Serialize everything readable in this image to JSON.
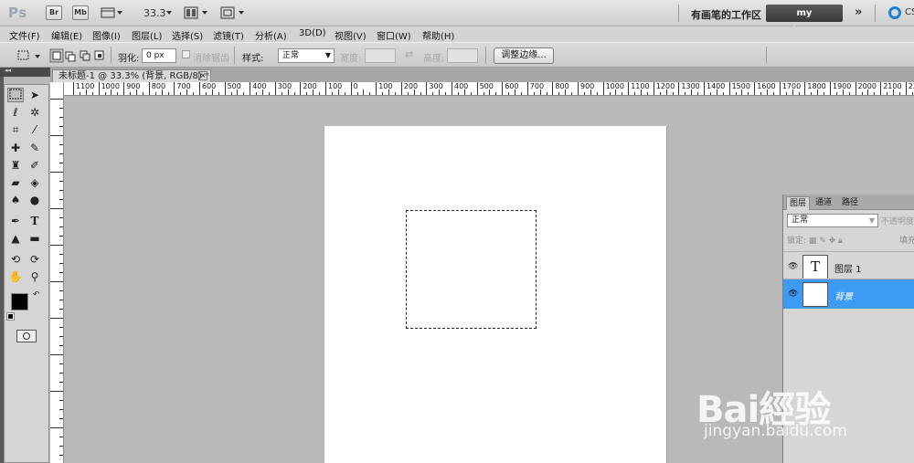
{
  "app": {
    "logo": "Ps",
    "bridge_btn": "Br",
    "minibridge_btn": "Mb",
    "zoom": "33.3",
    "workspace_label": "有画笔的工作区",
    "workspace_active": "my workspace1",
    "more": "»",
    "cs_label": "CS"
  },
  "menus": [
    "文件(F)",
    "编辑(E)",
    "图像(I)",
    "图层(L)",
    "选择(S)",
    "滤镜(T)",
    "分析(A)",
    "3D(D)",
    "视图(V)",
    "窗口(W)",
    "帮助(H)"
  ],
  "options": {
    "feather_label": "羽化:",
    "feather_value": "0 px",
    "antialias_label": "消除锯齿",
    "style_label": "样式:",
    "style_value": "正常",
    "width_label": "宽度:",
    "height_label": "高度:",
    "refine_btn": "调整边缘..."
  },
  "document": {
    "tab_title": "未标题-1 @ 33.3% (背景, RGB/8) *",
    "close": "×",
    "ruler_labels": [
      "1100",
      "1000",
      "900",
      "800",
      "700",
      "600",
      "500",
      "400",
      "300",
      "200",
      "100",
      "0",
      "100",
      "200",
      "300",
      "400",
      "500",
      "600",
      "700",
      "800",
      "900",
      "1000",
      "1100",
      "1200",
      "1300",
      "1400",
      "1500",
      "1600",
      "1700",
      "1800",
      "1900",
      "2000",
      "2100",
      "2200",
      "2300"
    ]
  },
  "layers_panel": {
    "tabs": [
      "图层",
      "通道",
      "路径"
    ],
    "blend_mode": "正常",
    "opacity_label": "不透明度",
    "lock_label": "锁定:",
    "fill_label": "填充",
    "layers": [
      {
        "name": "图层 1",
        "thumb": "T",
        "selected": false,
        "italic": false
      },
      {
        "name": "背景",
        "thumb": "",
        "selected": true,
        "italic": true
      }
    ]
  },
  "watermark": {
    "logo": "Bai經验",
    "url": "jingyan.baidu.com"
  },
  "colors": {
    "accent": "#3e9bf5",
    "foreground_swatch": "#000000",
    "background_swatch": "#ffffff"
  }
}
